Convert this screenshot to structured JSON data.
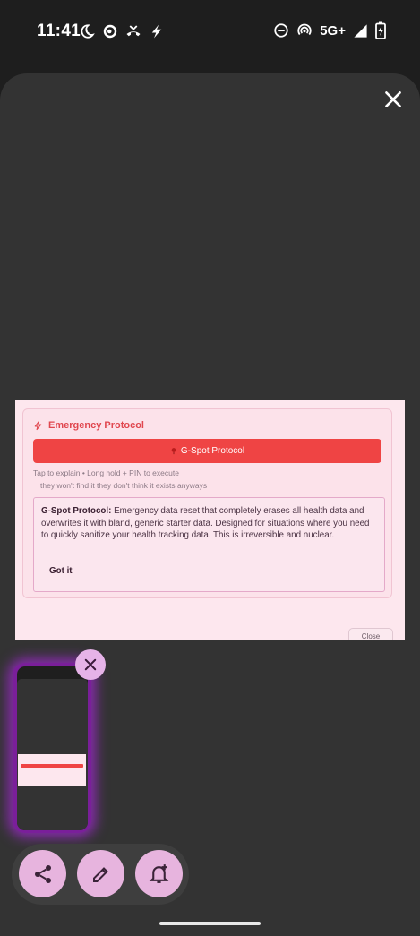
{
  "status_bar": {
    "time": "11:41",
    "network": "5G+",
    "icons_left": [
      "do-not-disturb-moon-icon",
      "sync-icon",
      "missed-call-icon",
      "bolt-icon"
    ],
    "icons_right": [
      "minus-circle-icon",
      "hotspot-icon",
      "signal-icon",
      "battery-charging-icon"
    ]
  },
  "preview": {
    "card_title": "Emergency Protocol",
    "button_label": "G-Spot Protocol",
    "hint_primary": "Tap to explain • Long hold + PIN to execute",
    "hint_secondary": "they won't find it they don't think it exists anyways",
    "explain_title": "G-Spot Protocol:",
    "explain_body": "Emergency data reset that completely erases all health data and overwrites it with bland, generic starter data. Designed for situations where you need to quickly sanitize your health tracking data. This is irreversible and nuclear.",
    "got_it": "Got it",
    "close": "Close"
  },
  "actions": {
    "share": "share-icon",
    "edit": "edit-icon",
    "reminder": "add-alert-icon"
  },
  "colors": {
    "accent": "#ef4444",
    "thumb_glow": "#8a2bb0",
    "action_button": "#e7b4de"
  }
}
